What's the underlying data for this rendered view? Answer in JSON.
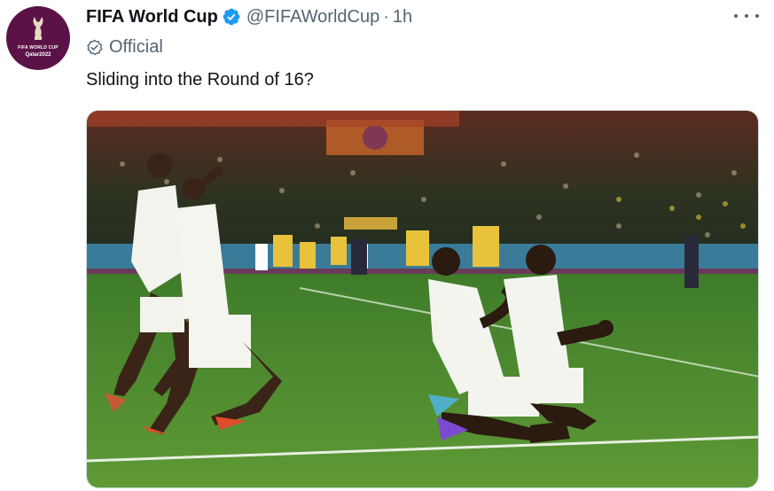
{
  "tweet": {
    "display_name": "FIFA World Cup",
    "handle": "@FIFAWorldCup",
    "separator": "·",
    "timestamp": "1h",
    "label": "Official",
    "text": "Sliding into the Round of 16?",
    "avatar_text_line1": "FIFA WORLD CUP",
    "avatar_text_line2": "Qatar2022"
  },
  "icons": {
    "verified": "verified-badge-icon",
    "official": "official-check-icon",
    "more": "more-options-icon"
  },
  "colors": {
    "verified_blue": "#1d9bf0",
    "avatar_bg": "#5b1347",
    "secondary_text": "#536471"
  }
}
